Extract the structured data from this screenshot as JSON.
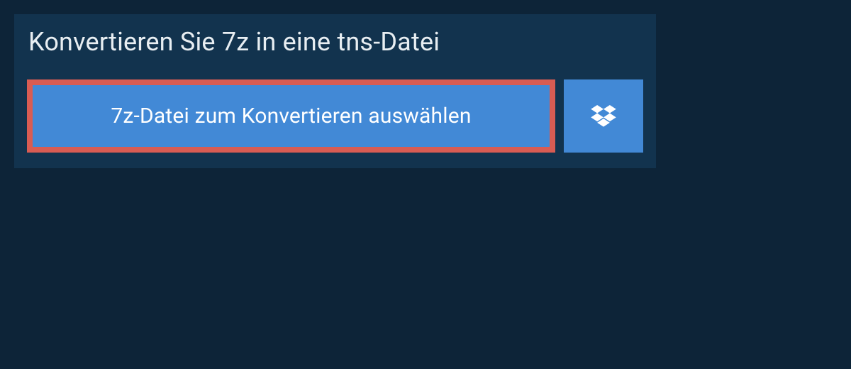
{
  "heading": "Konvertieren Sie 7z in eine tns-Datei",
  "select_button_label": "7z-Datei zum Konvertieren auswählen",
  "icons": {
    "dropbox": "dropbox-icon"
  },
  "colors": {
    "background": "#0d2438",
    "panel": "#12334e",
    "button": "#4289d6",
    "highlight_border": "#d85c53",
    "text_light": "#e8eef2",
    "text_white": "#ffffff"
  }
}
